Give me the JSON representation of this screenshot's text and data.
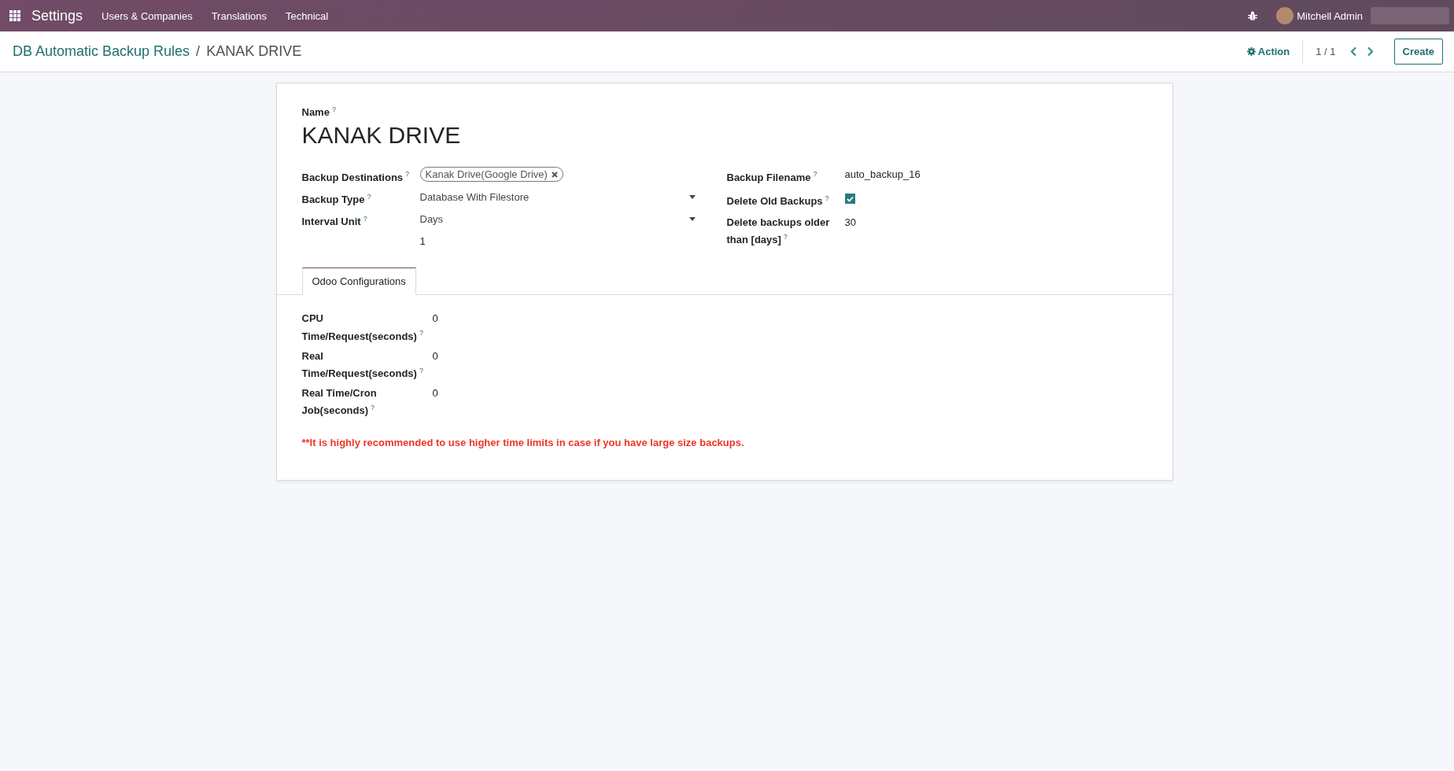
{
  "navbar": {
    "app_name": "Settings",
    "menus": [
      "Users & Companies",
      "Translations",
      "Technical"
    ],
    "user_name": "Mitchell Admin"
  },
  "breadcrumb": {
    "parent": "DB Automatic Backup Rules",
    "separator": "/",
    "current": "KANAK DRIVE"
  },
  "control_panel": {
    "action": "Action",
    "pager": "1 / 1",
    "create": "Create"
  },
  "form": {
    "name_label": "Name",
    "name_help": "?",
    "name": "KANAK DRIVE",
    "left_fields": [
      {
        "kind": "tags",
        "label": "Backup Destinations",
        "help": "?",
        "tags": [
          "Kanak Drive(Google Drive)"
        ]
      },
      {
        "kind": "select",
        "label": "Backup Type",
        "help": "?",
        "value": "Database With Filestore"
      },
      {
        "kind": "select",
        "label": "Interval Unit",
        "help": "?",
        "value": "Days"
      },
      {
        "kind": "text",
        "value": "1"
      }
    ],
    "right_fields": [
      {
        "kind": "text",
        "label": "Backup Filename",
        "help": "?",
        "value": "auto_backup_16"
      },
      {
        "kind": "checkbox",
        "label": "Delete Old Backups",
        "help": "?",
        "checked": true
      },
      {
        "kind": "text",
        "label": "Delete backups older than [days]",
        "help": "?",
        "value": "30"
      }
    ],
    "tabs": [
      {
        "label": "Odoo Configurations",
        "selected": true
      }
    ],
    "tab_fields": [
      {
        "label": "CPU Time/Request(seconds)",
        "help": "?",
        "value": "0"
      },
      {
        "label": "Real Time/Request(seconds)",
        "help": "?",
        "value": "0"
      },
      {
        "label": "Real Time/Cron Job(seconds)",
        "help": "?",
        "value": "0"
      }
    ],
    "note": "**It is highly recommended to use higher time limits in case if you have large size backups."
  }
}
